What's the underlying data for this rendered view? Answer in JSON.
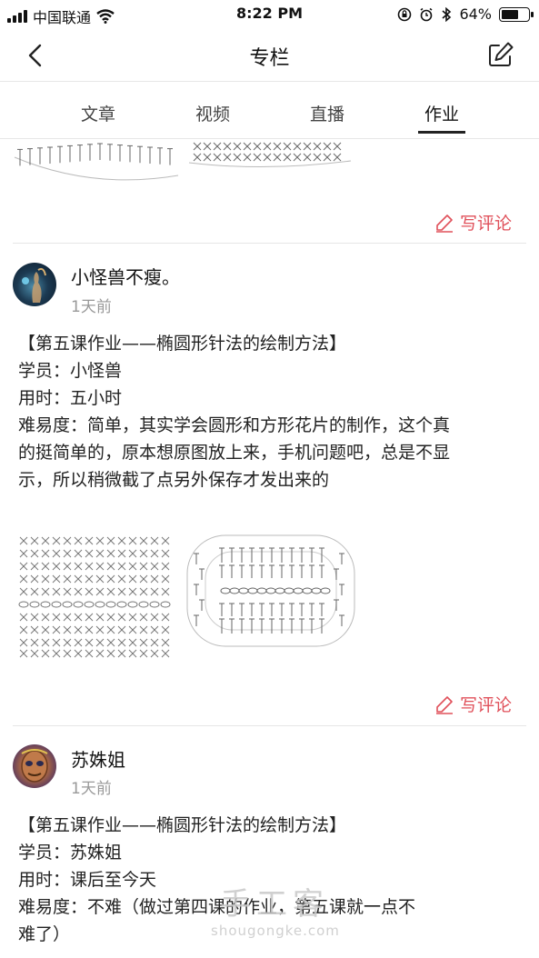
{
  "status_bar": {
    "carrier": "中国联通",
    "time": "8:22 PM",
    "battery": "64%",
    "battery_level": 0.64
  },
  "nav": {
    "title": "专栏"
  },
  "tabs": [
    {
      "label": "文章"
    },
    {
      "label": "视频"
    },
    {
      "label": "直播"
    },
    {
      "label": "作业"
    }
  ],
  "active_tab": "作业",
  "write_comment_label": "写评论",
  "posts": [
    {
      "user": "小怪兽不瘦。",
      "time": "1天前",
      "lines": [
        "【第五课作业——椭圆形针法的绘制方法】",
        "学员：小怪兽",
        "用时：五小时",
        "难易度：简单，其实学会圆形和方形花片的制作，这个真",
        "的挺简单的，原本想原图放上来，手机问题吧，总是不显",
        "示，所以稍微截了点另外保存才发出来的"
      ]
    },
    {
      "user": "苏姝姐",
      "time": "1天前",
      "lines": [
        "【第五课作业——椭圆形针法的绘制方法】",
        "学员：苏姝姐",
        "用时：课后至今天",
        "难易度：不难（做过第四课的作业，第五课就一点不",
        "难了）"
      ]
    }
  ],
  "watermark": {
    "text": "手工客",
    "url": "shougongke.com"
  },
  "colors": {
    "accent_red": "#e0505a",
    "divider": "#e6e6e6",
    "muted": "#999999"
  }
}
